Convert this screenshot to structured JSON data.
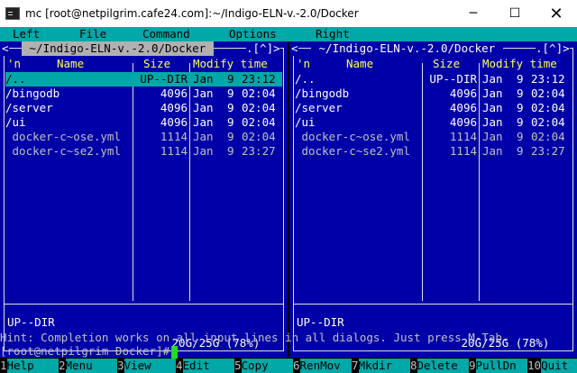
{
  "window": {
    "title": "mc [root@netpilgrim.cafe24.com]:~/Indigo-ELN-v.-2.0/Docker",
    "minimize": "─",
    "maximize": "☐",
    "close": "✕"
  },
  "menubar": {
    "items": [
      "Left",
      "File",
      "Command",
      "Options",
      "Right"
    ]
  },
  "left_panel": {
    "path": " ~/Indigo-ELN-v.-2.0/Docker ",
    "corner_left": "<",
    "corner_right": ".[^]>",
    "columns": {
      "sort": "'n",
      "name": "Name",
      "size": "Size",
      "modify": "Modify time"
    },
    "rows": [
      {
        "name": "/..",
        "size": "UP--DIR",
        "month": "Jan",
        "day": "9",
        "time": "23:12",
        "selected": true,
        "dir": true
      },
      {
        "name": "/bingodb",
        "size": "4096",
        "month": "Jan",
        "day": "9",
        "time": "02:04",
        "selected": false,
        "dir": true
      },
      {
        "name": "/server",
        "size": "4096",
        "month": "Jan",
        "day": "9",
        "time": "02:04",
        "selected": false,
        "dir": true
      },
      {
        "name": "/ui",
        "size": "4096",
        "month": "Jan",
        "day": "9",
        "time": "02:04",
        "selected": false,
        "dir": true
      },
      {
        "name": " docker-c~ose.yml",
        "size": "1114",
        "month": "Jan",
        "day": "9",
        "time": "02:04",
        "selected": false,
        "dir": false
      },
      {
        "name": " docker-c~se2.yml",
        "size": "1114",
        "month": "Jan",
        "day": "9",
        "time": "23:27",
        "selected": false,
        "dir": false
      }
    ],
    "status": "UP--DIR",
    "disk": " 20G/25G (78%) "
  },
  "right_panel": {
    "path": " ~/Indigo-ELN-v.-2.0/Docker ",
    "corner_left": "<",
    "corner_right": ".[^]>",
    "columns": {
      "sort": "'n",
      "name": "Name",
      "size": "Size",
      "modify": "Modify time"
    },
    "rows": [
      {
        "name": "/..",
        "size": "UP--DIR",
        "month": "Jan",
        "day": "9",
        "time": "23:12",
        "selected": false,
        "dir": true
      },
      {
        "name": "/bingodb",
        "size": "4096",
        "month": "Jan",
        "day": "9",
        "time": "02:04",
        "selected": false,
        "dir": true
      },
      {
        "name": "/server",
        "size": "4096",
        "month": "Jan",
        "day": "9",
        "time": "02:04",
        "selected": false,
        "dir": true
      },
      {
        "name": "/ui",
        "size": "4096",
        "month": "Jan",
        "day": "9",
        "time": "02:04",
        "selected": false,
        "dir": true
      },
      {
        "name": " docker-c~ose.yml",
        "size": "1114",
        "month": "Jan",
        "day": "9",
        "time": "02:04",
        "selected": false,
        "dir": false
      },
      {
        "name": " docker-c~se2.yml",
        "size": "1114",
        "month": "Jan",
        "day": "9",
        "time": "23:27",
        "selected": false,
        "dir": false
      }
    ],
    "status": "UP--DIR",
    "disk": " 20G/25G (78%) "
  },
  "hint": "Hint: Completion works on all input lines in all dialogs. Just press M-Tab.",
  "prompt": "[root@netpilgrim Docker]#",
  "fkeys": [
    {
      "num": "1",
      "label": "Help"
    },
    {
      "num": "2",
      "label": "Menu"
    },
    {
      "num": "3",
      "label": "View"
    },
    {
      "num": "4",
      "label": "Edit"
    },
    {
      "num": "5",
      "label": "Copy"
    },
    {
      "num": "6",
      "label": "RenMov"
    },
    {
      "num": "7",
      "label": "Mkdir"
    },
    {
      "num": "8",
      "label": "Delete"
    },
    {
      "num": "9",
      "label": "PullDn"
    },
    {
      "num": "10",
      "label": "Quit"
    }
  ],
  "colors": {
    "panel_bg": "#0000a8",
    "accent_cyan": "#00a8a8",
    "header_yellow": "#ffff54",
    "cursor_green": "#22dd22"
  }
}
